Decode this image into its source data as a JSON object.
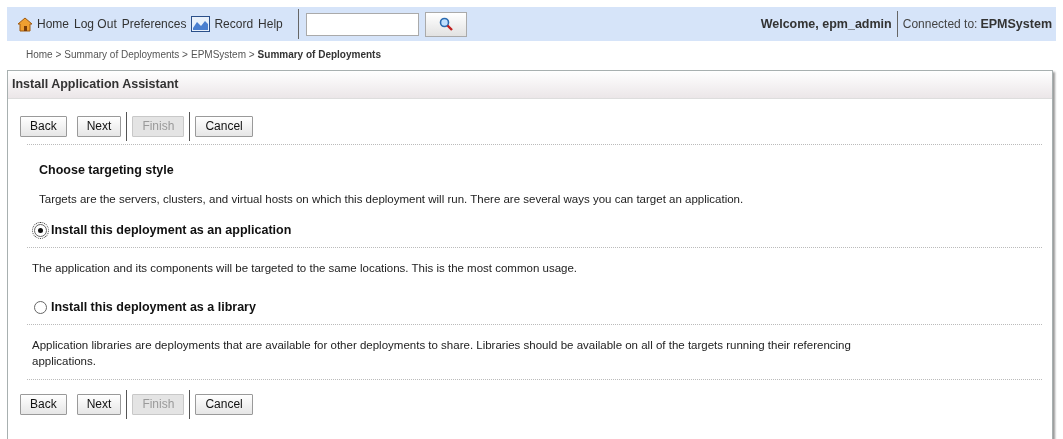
{
  "global_bar": {
    "links": [
      {
        "label": "Home",
        "kind": "home"
      },
      {
        "label": "Log Out"
      },
      {
        "label": "Preferences"
      },
      {
        "label": "Record",
        "kind": "record"
      },
      {
        "label": "Help"
      }
    ],
    "welcome": "Welcome, epm_admin",
    "connected_label": "Connected to:",
    "connected_value": "EPMSystem"
  },
  "breadcrumb": [
    {
      "label": "Home >",
      "current": false
    },
    {
      "label": "Summary of Deployments >",
      "current": false
    },
    {
      "label": "EPMSystem >",
      "current": false
    },
    {
      "label": "Summary of Deployments",
      "current": true
    }
  ],
  "panel": {
    "title": "Install Application Assistant",
    "top_buttons": [
      [
        {
          "label": "Back",
          "disabled": false
        },
        {
          "label": "Next",
          "disabled": false
        }
      ],
      [
        {
          "label": "Finish",
          "disabled": true
        }
      ],
      [
        {
          "label": "Cancel",
          "disabled": false
        }
      ]
    ],
    "section_title": "Choose targeting style",
    "intro": "Targets are the servers, clusters, and virtual hosts on which this deployment will run. There are several ways you can target an application.",
    "options": [
      {
        "label": "Install this deployment as an application",
        "selected": true,
        "description": "The application and its components will be targeted to the same locations. This is the most common usage."
      },
      {
        "label": "Install this deployment as a library",
        "selected": false,
        "description": "Application libraries are deployments that are available for other deployments to share. Libraries should be available on all of the targets running their referencing applications."
      }
    ],
    "bottom_buttons": [
      [
        {
          "label": "Back",
          "disabled": false
        },
        {
          "label": "Next",
          "disabled": false
        }
      ],
      [
        {
          "label": "Finish",
          "disabled": true
        }
      ],
      [
        {
          "label": "Cancel",
          "disabled": false
        }
      ]
    ]
  }
}
